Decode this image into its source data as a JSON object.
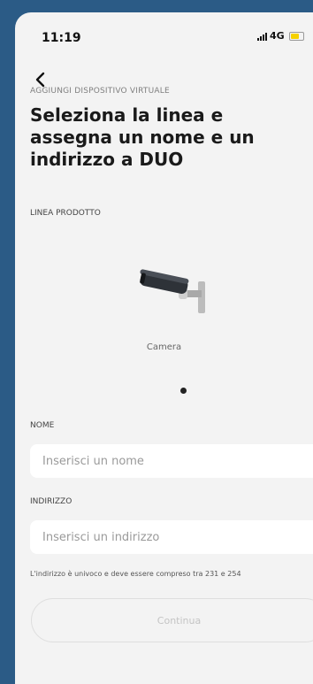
{
  "status_bar": {
    "time": "11:19",
    "network": "4G",
    "battery_color": "#f5d100"
  },
  "header": {
    "back_icon": "chevron-left-icon",
    "overline": "AGGIUNGI DISPOSITIVO VIRTUALE",
    "title": "Seleziona la linea e assegna un nome e un indirizzo a DUO"
  },
  "product_line": {
    "label": "LINEA PRODOTTO",
    "selected_item": {
      "icon": "camera-icon",
      "caption": "Camera"
    },
    "page_indicator": {
      "current": 1,
      "total": 1
    }
  },
  "name_field": {
    "label": "NOME",
    "value": "",
    "placeholder": "Inserisci un nome"
  },
  "address_field": {
    "label": "INDIRIZZO",
    "value": "",
    "placeholder": "Inserisci un indirizzo",
    "helper": "L'indirizzo è univoco e deve essere compreso tra 231 e 254"
  },
  "continue_button": {
    "label": "Continua",
    "enabled": false
  },
  "colors": {
    "frame": "#2b5b86",
    "screen_background": "#f3f3f3",
    "title": "#1a1a1a",
    "disabled_text": "#c4c4c4"
  }
}
